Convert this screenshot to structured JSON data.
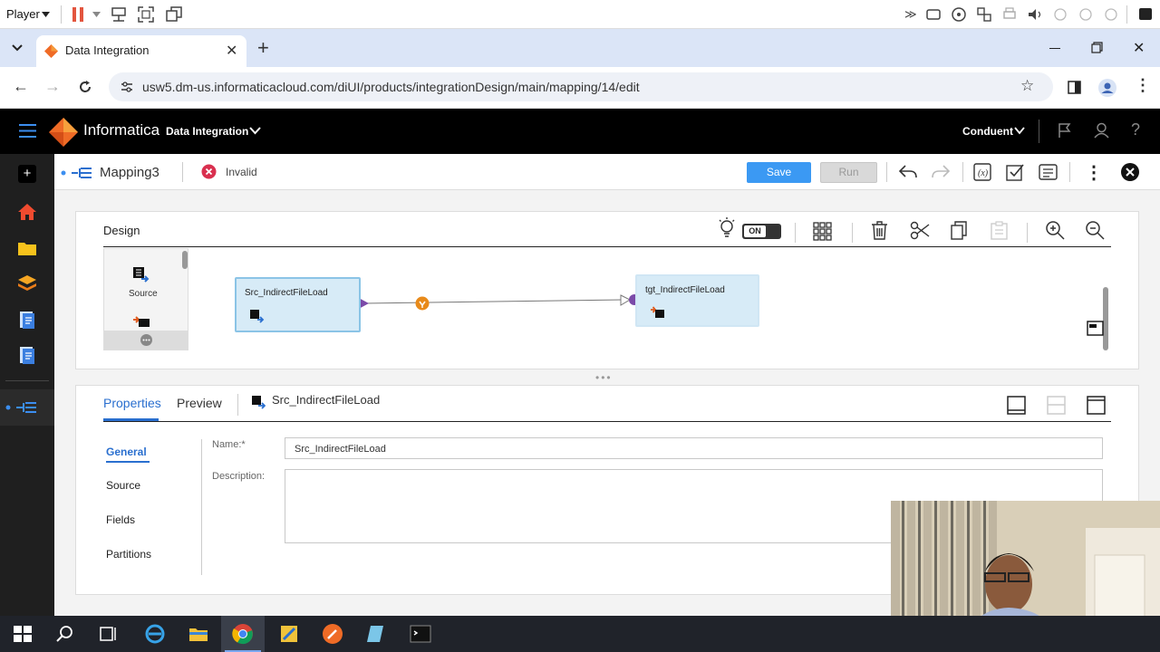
{
  "player": {
    "label": "Player"
  },
  "browser": {
    "tab_title": "Data Integration",
    "url": "usw5.dm-us.informaticacloud.com/diUI/products/integrationDesign/main/mapping/14/edit"
  },
  "app": {
    "brand": "Informatica",
    "product": "Data Integration",
    "org": "Conduent"
  },
  "toolbar": {
    "mapping_name": "Mapping3",
    "status": "Invalid",
    "save_label": "Save",
    "run_label": "Run"
  },
  "design": {
    "heading": "Design",
    "toggle_label": "ON",
    "palette_source_label": "Source",
    "nodes": {
      "source": "Src_IndirectFileLoad",
      "target": "tgt_IndirectFileLoad"
    }
  },
  "properties": {
    "tabs": [
      "Properties",
      "Preview"
    ],
    "selected_object": "Src_IndirectFileLoad",
    "side_nav": [
      "General",
      "Source",
      "Fields",
      "Partitions"
    ],
    "name_label": "Name:*",
    "name_value": "Src_IndirectFileLoad",
    "description_label": "Description:",
    "description_value": ""
  },
  "colors": {
    "accent": "#3b99f3",
    "invalid": "#d9304f",
    "node_fill": "#d7ebf7",
    "link_marker": "#e88a1a",
    "port": "#7b4aa8"
  },
  "icons": {
    "app_menu": "hamburger-icon",
    "rail": [
      "plus-icon",
      "home-icon",
      "folder-icon",
      "layers-icon",
      "document-icon",
      "document-icon",
      "mapping-icon"
    ]
  }
}
